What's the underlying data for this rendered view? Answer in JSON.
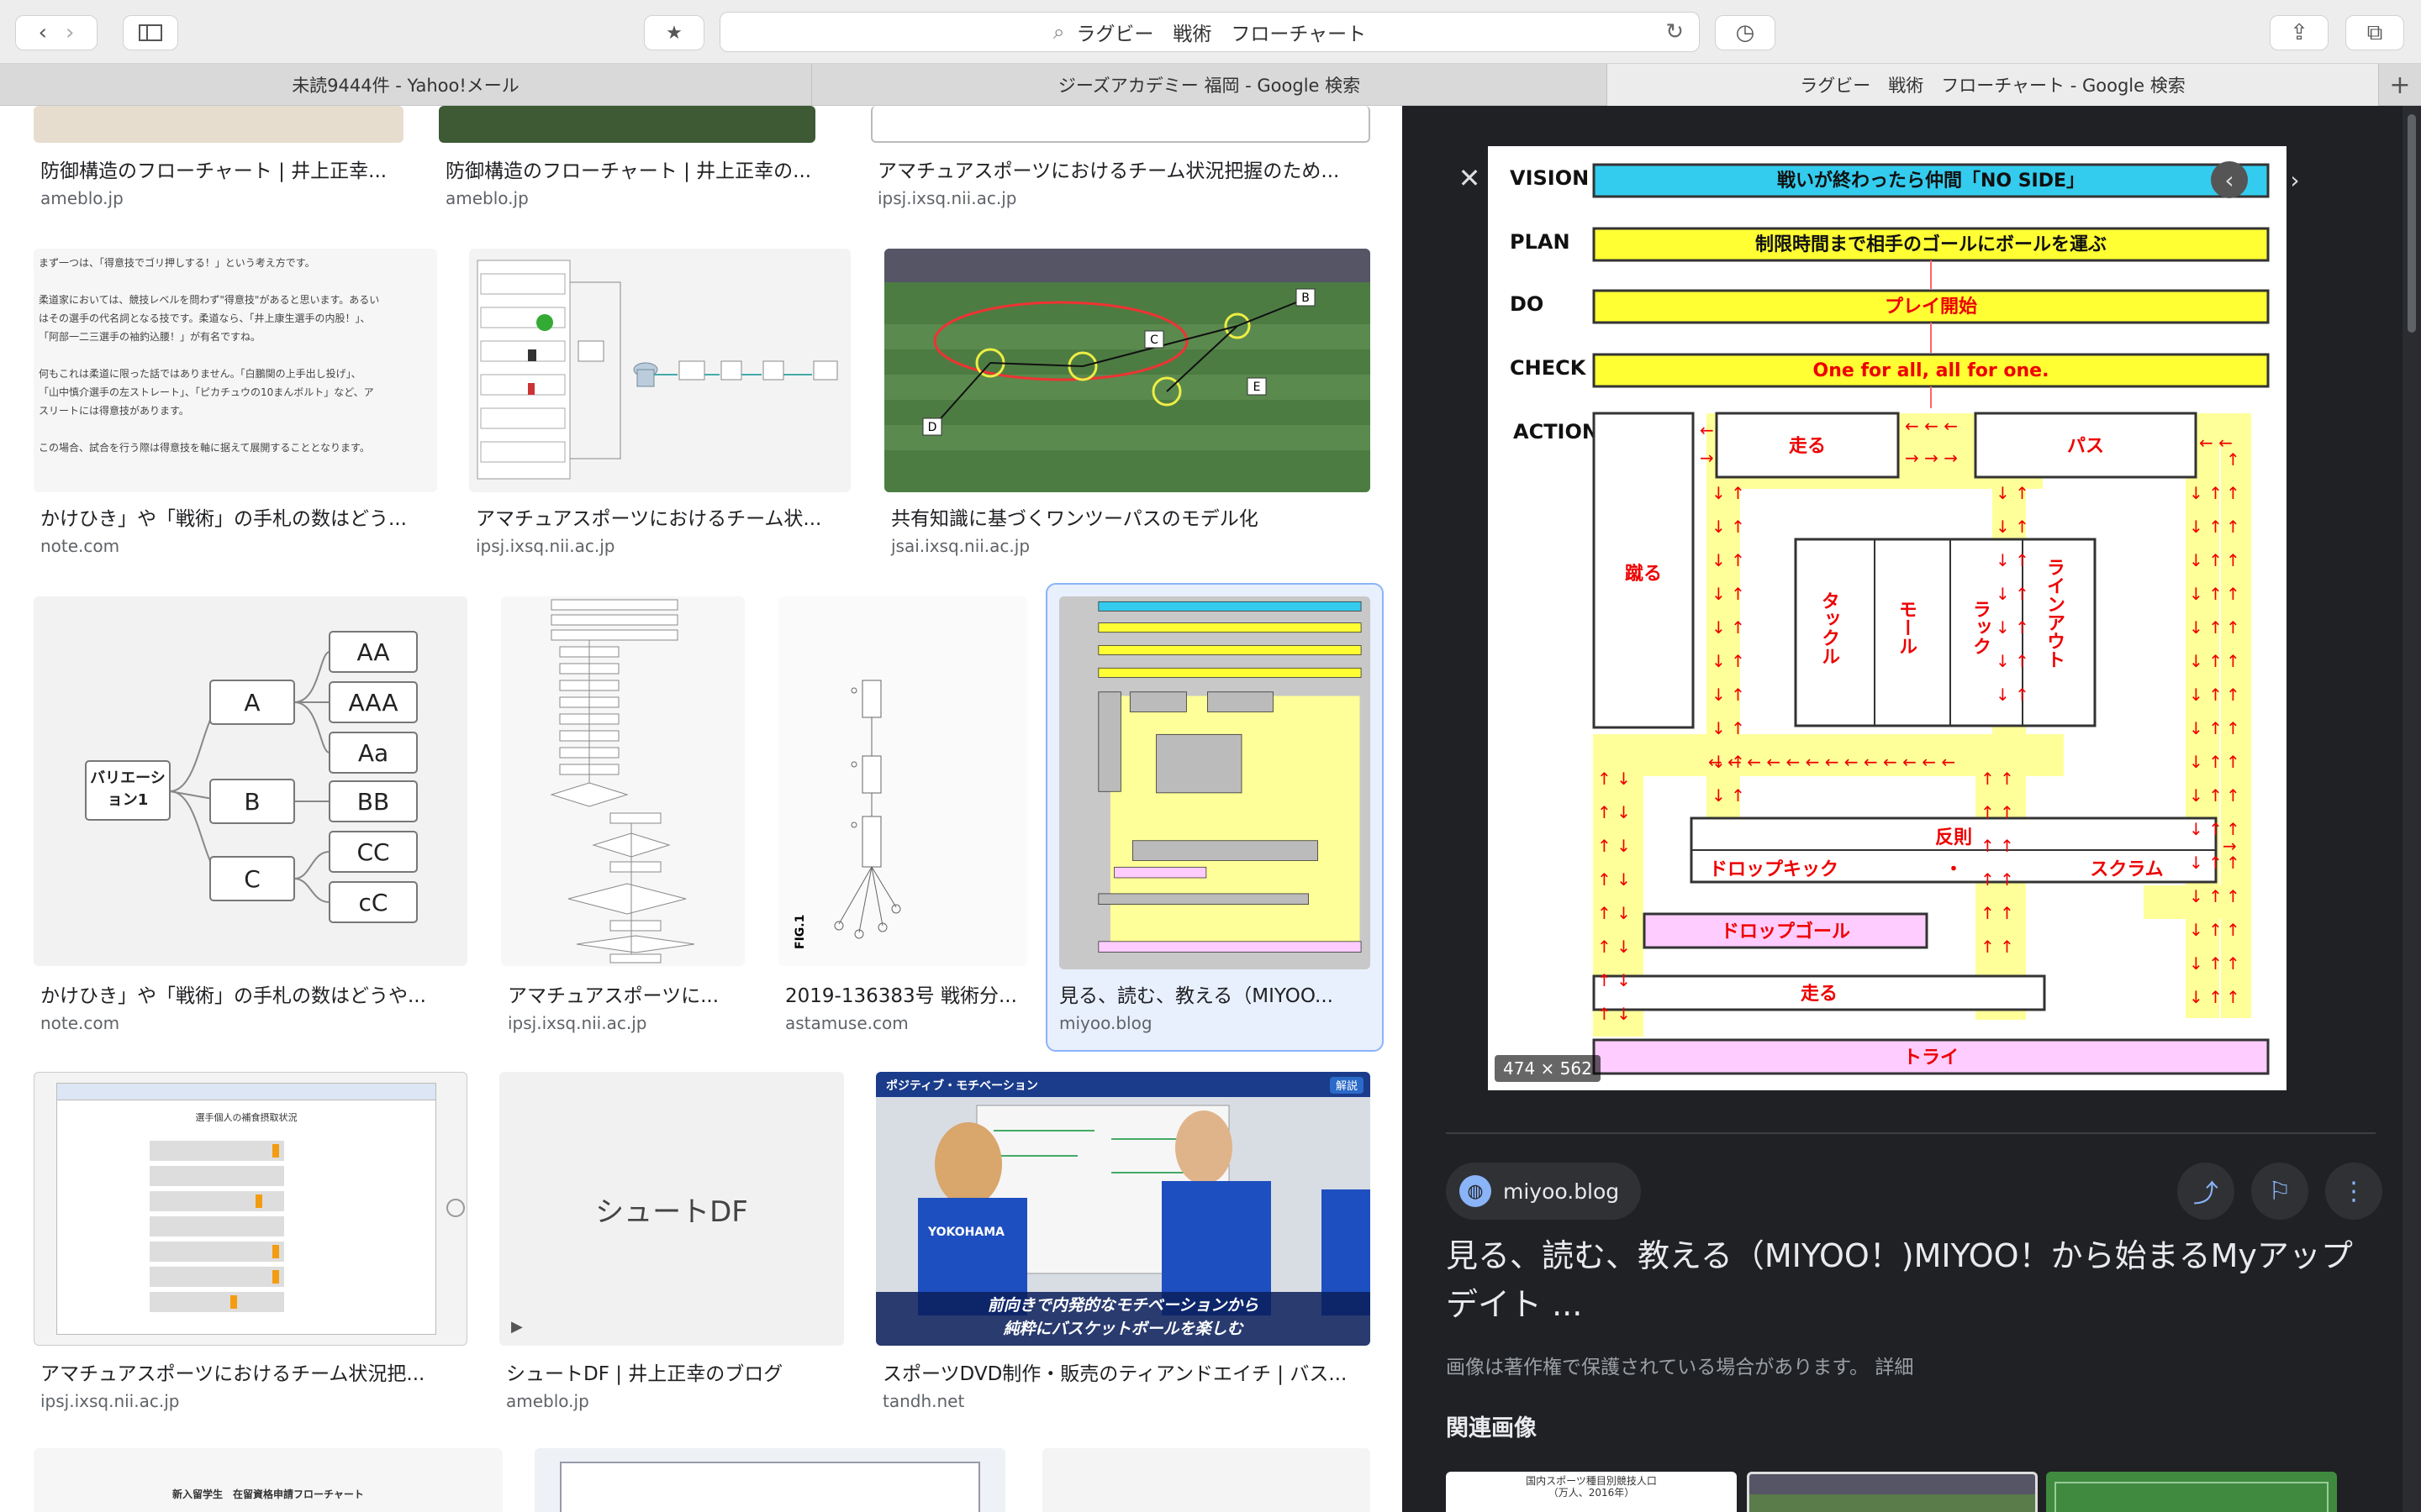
{
  "toolbar": {
    "address": "ラグビー　戦術　フローチャート"
  },
  "tabs": [
    "未読9444件 - Yahoo!メール",
    "ジーズアカデミー 福岡 - Google 検索",
    "ラグビー　戦術　フローチャート - Google 検索"
  ],
  "results": {
    "row0": [
      {
        "title": "防御構造のフローチャート | 井上正幸...",
        "source": "ameblo.jp"
      },
      {
        "title": "防御構造のフローチャート | 井上正幸の...",
        "source": "ameblo.jp"
      },
      {
        "title": "アマチュアスポーツにおけるチーム状況把握のため...",
        "source": "ipsj.ixsq.nii.ac.jp"
      }
    ],
    "row1": [
      {
        "title": "かけひき」や「戦術」の手札の数はどう...",
        "source": "note.com"
      },
      {
        "title": "アマチュアスポーツにおけるチーム状...",
        "source": "ipsj.ixsq.nii.ac.jp"
      },
      {
        "title": "共有知識に基づくワンツーパスのモデル化",
        "source": "jsai.ixsq.nii.ac.jp"
      }
    ],
    "row2": [
      {
        "title": "かけひき」や「戦術」の手札の数はどうや...",
        "source": "note.com"
      },
      {
        "title": "アマチュアスポーツに...",
        "source": "ipsj.ixsq.nii.ac.jp"
      },
      {
        "title": "2019-136383号 戦術分...",
        "source": "astamuse.com"
      },
      {
        "title": "見る、読む、教える（MIYOO...",
        "source": "miyoo.blog"
      }
    ],
    "row3": [
      {
        "title": "アマチュアスポーツにおけるチーム状況把...",
        "source": "ipsj.ixsq.nii.ac.jp"
      },
      {
        "title": "シュートDF | 井上正幸のブログ",
        "source": "ameblo.jp"
      },
      {
        "title": "スポーツDVD制作・販売のティアンドエイチ | バス...",
        "source": "tandh.net"
      }
    ]
  },
  "thumbs": {
    "variation_tree": {
      "root": "バリエーション1",
      "mid": [
        "A",
        "B",
        "C"
      ],
      "leaves": [
        "AA",
        "AAA",
        "Aa",
        "BB",
        "CC",
        "cC"
      ]
    },
    "shoot_df": "シュートDF",
    "note_text": [
      "まず一つは、「得意技でゴリ押しする！」という考え方です。",
      "柔道家においては、競技レベルを問わず\"得意技\"があると思います。あるい",
      "はその選手の代名詞となる技です。柔道なら、「井上康生選手の内股！」、",
      "「阿部一二三選手の袖釣込腰！」が有名ですね。",
      "何もこれは柔道に限った話ではありません。「白鵬関の上手出し投げ」、",
      "「山中慎介選手の左ストレート」、「ピカチュウの10まんボルト」など、ア",
      "スリートには得意技があります。",
      "この場合、試合を行う際は得意技を軸に据えて展開することとなります。"
    ],
    "dvd_banner": "ポジティブ・モチベーション",
    "dvd_caption": "前向きで内発的なモチベーションから\n純粋にバスケットボールを楽しむ",
    "dvd_badge": "解説",
    "dvd_jersey": "YOKOHAMA",
    "field_labels": [
      "B",
      "C",
      "D",
      "E"
    ],
    "lower_doc": "新入留学生　在留資格申請フローチャート",
    "related_pop": "国内スポーツ種目別競技人口",
    "related_pop_unit": "（万人、2016年）",
    "fig_label": "FIG.1",
    "worksheet_title": "選手個人の補食摂取状況"
  },
  "panel": {
    "dimensions": "474 × 562",
    "site": "miyoo.blog",
    "title": "見る、読む、教える（MIYOO！)MIYOO！から始まるMyアップデイト ...",
    "copyright": "画像は著作権で保護されている場合があります。 詳細",
    "related": "関連画像"
  },
  "flowchart": {
    "labels": {
      "vision": "VISION",
      "plan": "PLAN",
      "do": "DO",
      "check": "CHECK",
      "action": "ACTION"
    },
    "vision_text": "戦いが終わったら仲間「NO SIDE」",
    "plan_text": "制限時間まで相手のゴールにボールを運ぶ",
    "do_text": "プレイ開始",
    "check_text": "One for all, all for one.",
    "run1": "走る",
    "pass": "パス",
    "kick": "蹴る",
    "tackle": "タックル",
    "maul": "モール",
    "ruck": "ラック",
    "lineout": "ラインアウト",
    "foul": "反則",
    "dropkick": "ドロップキック",
    "dot": "・",
    "scrum": "スクラム",
    "dropgoal": "ドロップゴール",
    "run2": "走る",
    "try": "トライ"
  },
  "colors": {
    "accent": "#8ab4f8",
    "cyan": "#33ccee",
    "yellow": "#ffff33",
    "pink": "#ffccff",
    "red": "#ff0000"
  }
}
